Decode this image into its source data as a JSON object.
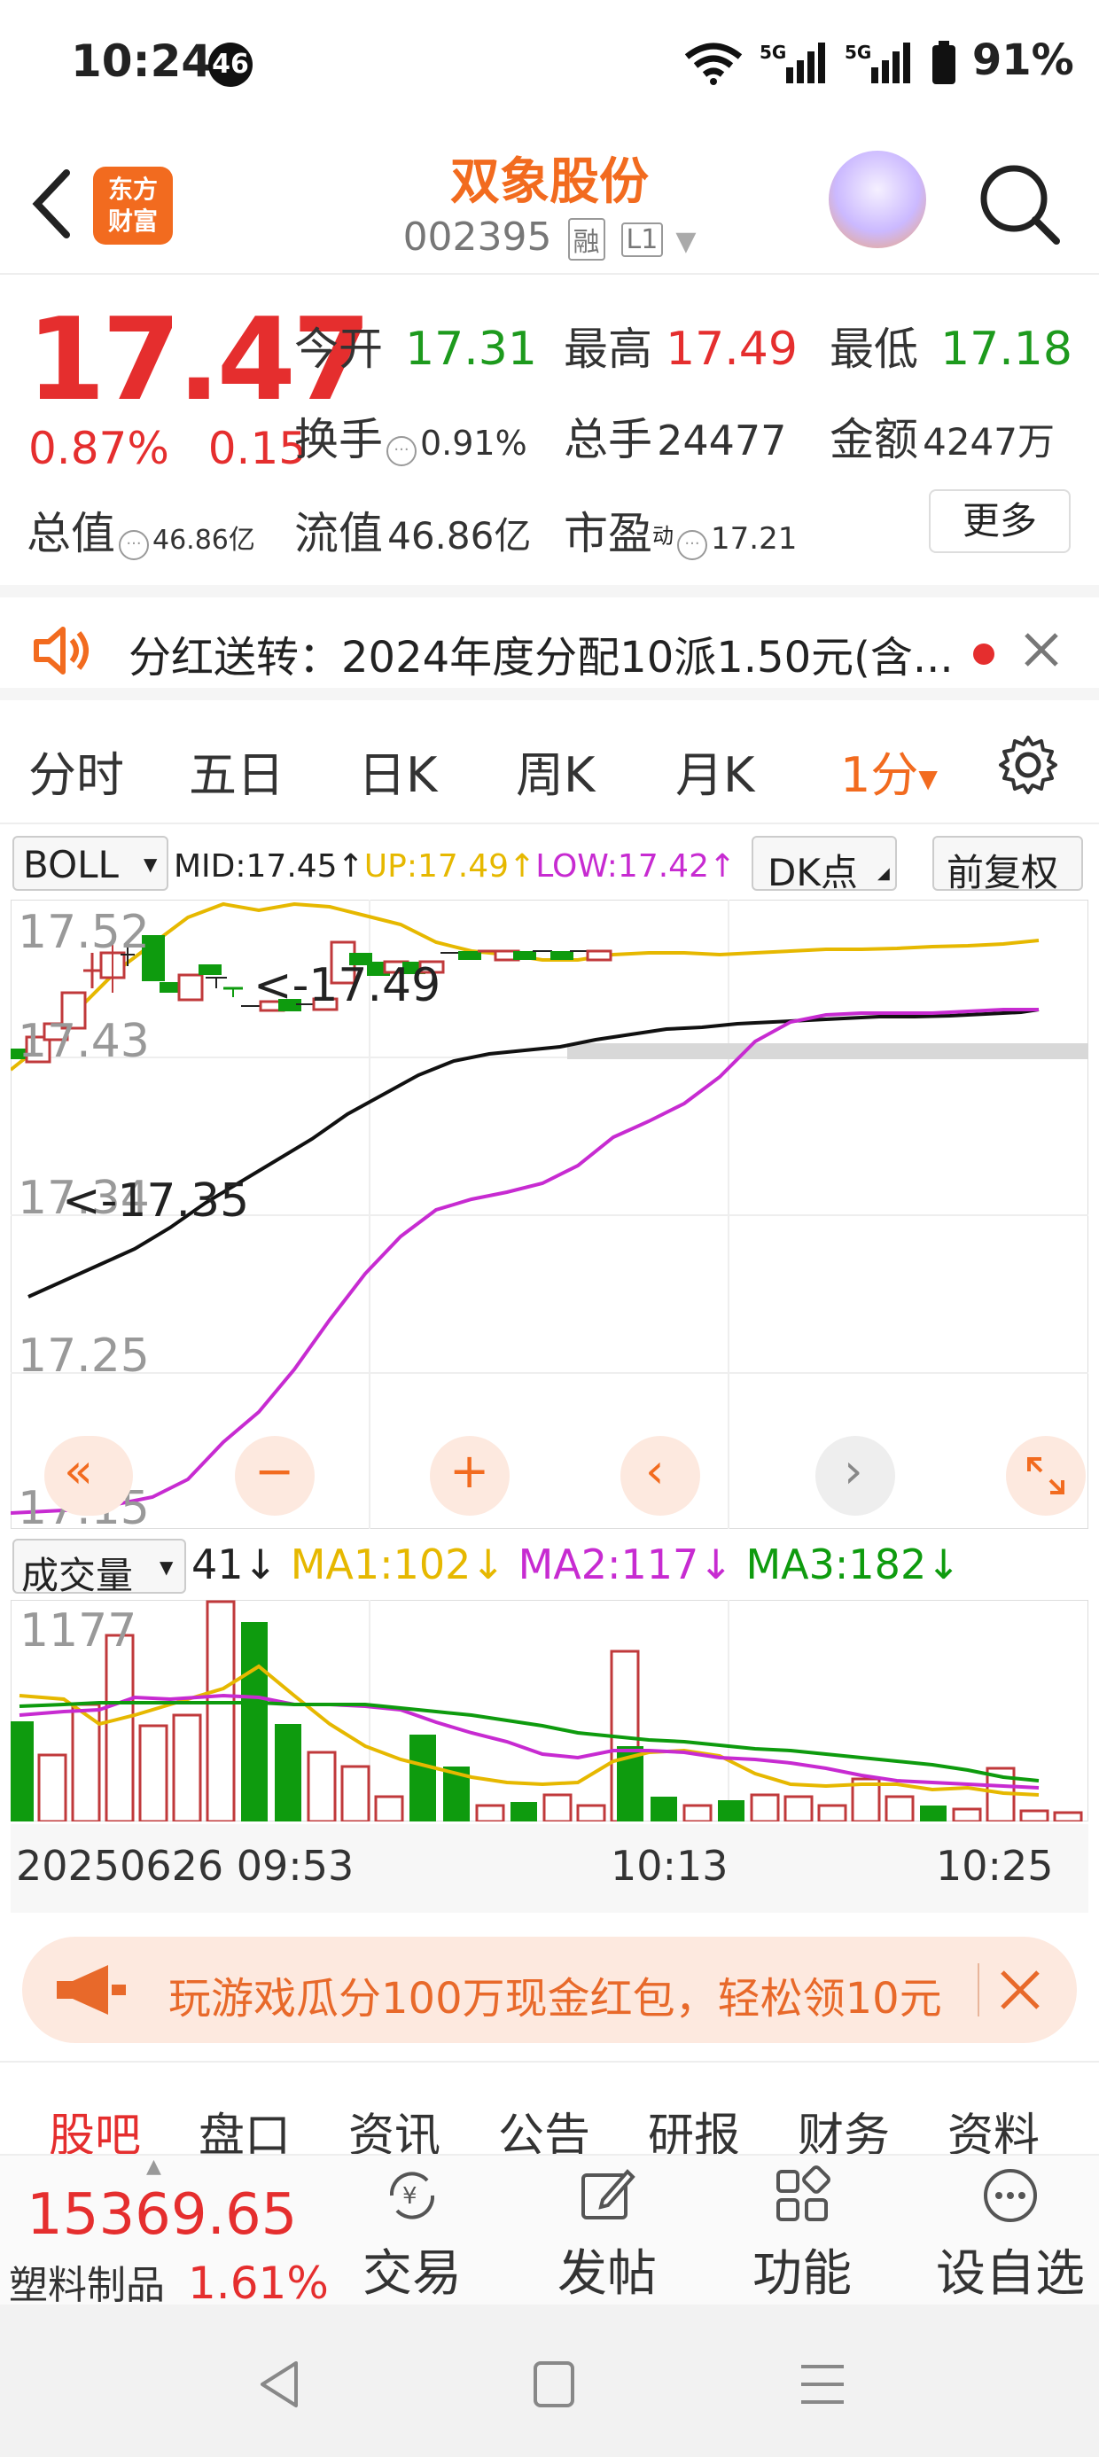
{
  "status": {
    "time": "10:24",
    "badge": "46",
    "network": "5G 5G",
    "battery": "91%"
  },
  "header": {
    "logo_line1": "东方",
    "logo_line2": "财富",
    "stock_name": "双象股份",
    "stock_code": "002395",
    "tag_margin": "融",
    "tag_level": "L1"
  },
  "quote": {
    "price": "17.47",
    "change_pct": "0.87%",
    "change_abs": "0.15",
    "open_label": "今开",
    "open": "17.31",
    "high_label": "最高",
    "high": "17.49",
    "low_label": "最低",
    "low": "17.18",
    "turnover_label": "换手",
    "turnover": "0.91%",
    "volume_label": "总手",
    "volume": "24477",
    "amount_label": "金额",
    "amount": "4247万",
    "mktcap_label": "总值",
    "mktcap": "46.86亿",
    "float_label": "流值",
    "float_cap": "46.86亿",
    "pe_label": "市盈",
    "pe_sup": "动",
    "pe": "17.21",
    "more_label": "更多"
  },
  "notice": {
    "text": "分红送转：2024年度分配10派1.50元(含..."
  },
  "ktabs": [
    "分时",
    "五日",
    "日K",
    "周K",
    "月K",
    "1分"
  ],
  "indicator": {
    "name": "BOLL",
    "mid": "MID:17.45↑",
    "up": "UP:17.49↑",
    "low": "LOW:17.42↑",
    "dk_label": "DK点",
    "adjust_label": "前复权"
  },
  "chart_data": {
    "type": "candlestick",
    "y_ticks": [
      "17.52",
      "17.43",
      "17.34",
      "17.25",
      "17.15"
    ],
    "ylim": [
      17.15,
      17.52
    ],
    "annotations": [
      "<-17.49",
      "<-17.35"
    ],
    "x_labels": [
      "20250626 09:53",
      "10:13",
      "10:25"
    ],
    "volume": {
      "label": "成交量",
      "current": "41↓",
      "ma1": "MA1:102↓",
      "ma2": "MA2:117↓",
      "ma3": "MA3:182↓",
      "y_tick": "1177"
    }
  },
  "colors": {
    "up": "#c0393b",
    "down": "#0e9b0e",
    "mid": "#111111",
    "upper": "#e6b800",
    "lower": "#c72bd1",
    "accent": "#f26b1f"
  },
  "ad": {
    "text": "玩游戏瓜分100万现金红包，轻松领10元"
  },
  "btabs": [
    "股吧",
    "盘口",
    "资讯",
    "公告",
    "研报",
    "财务",
    "资料"
  ],
  "toolbar": {
    "index_value": "15369.65",
    "sector_name": "塑料制品",
    "sector_pct": "1.61%",
    "trade": "交易",
    "post": "发帖",
    "func": "功能",
    "watch": "设自选"
  }
}
